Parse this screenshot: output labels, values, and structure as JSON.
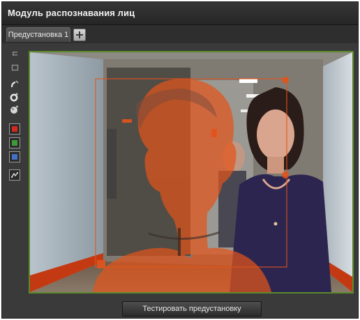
{
  "window": {
    "title": "Модуль распознавания лиц"
  },
  "tabs": [
    {
      "label": "Предустановка 1",
      "active": true
    }
  ],
  "add_tab_icon": "plus-icon",
  "toolbar": {
    "tools": [
      {
        "name": "line-tool-icon"
      },
      {
        "name": "rectangle-tool-icon"
      },
      {
        "name": "brush-tool-icon"
      },
      {
        "name": "ring-tool-icon"
      },
      {
        "name": "sphere-tool-icon"
      },
      {
        "name": "red-color-swatch",
        "color": "#d22a1f"
      },
      {
        "name": "green-color-swatch",
        "color": "#3f9a3a"
      },
      {
        "name": "blue-color-swatch",
        "color": "#4470c4"
      },
      {
        "name": "chart-tool-icon"
      }
    ]
  },
  "video": {
    "frame_color": "#5b8a2a",
    "overlay_color": "#e2541b"
  },
  "test_button": {
    "label": "Тестировать предустановку"
  }
}
